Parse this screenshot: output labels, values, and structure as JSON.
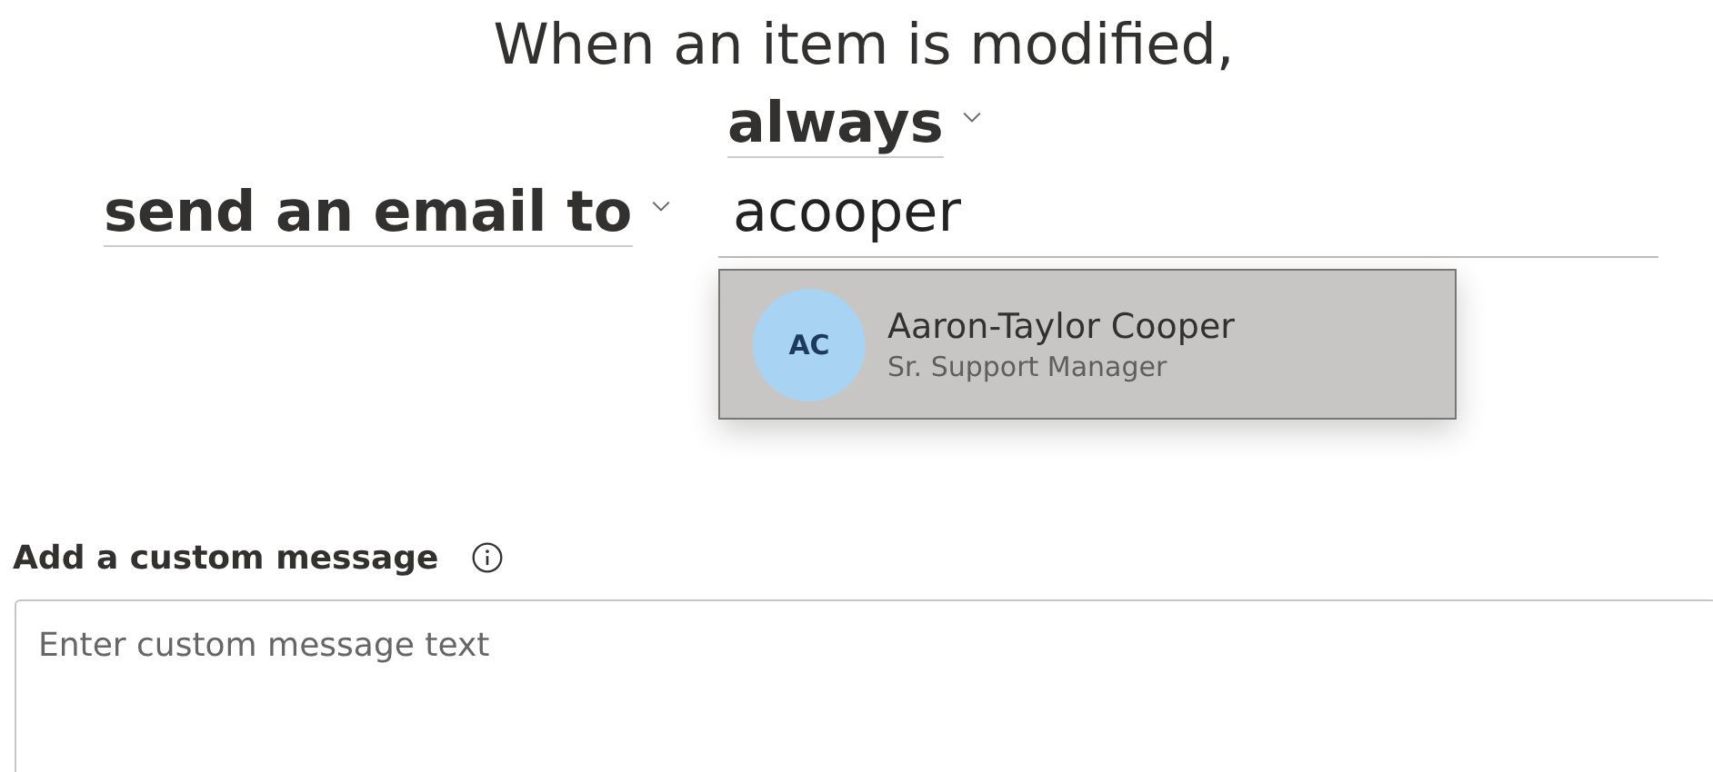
{
  "heading": "When an item is modified,",
  "frequency": {
    "value": "always"
  },
  "action": {
    "value": "send an email to"
  },
  "recipient": {
    "value": "acooper"
  },
  "suggestions": [
    {
      "initials": "AC",
      "name": "Aaron-Taylor Cooper",
      "title": "Sr. Support Manager",
      "color": "#a9d3f2"
    }
  ],
  "message": {
    "label": "Add a custom message",
    "placeholder": "Enter custom message text"
  }
}
